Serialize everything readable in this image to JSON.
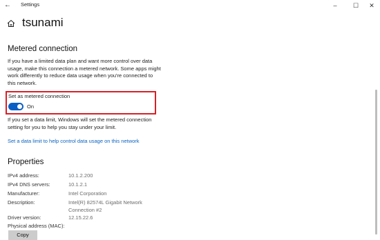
{
  "titlebar": {
    "back_glyph": "←",
    "title": "Settings",
    "minimize_glyph": "–",
    "maximize_glyph": "☐",
    "close_glyph": "✕"
  },
  "header": {
    "title": "tsunami",
    "icon": "home-icon"
  },
  "metered": {
    "heading": "Metered connection",
    "description_lines": [
      "If you have a limited data plan and want more control over data",
      "usage, make this connection a metered network. Some apps might",
      "work differently to reduce data usage when you're connected to",
      "this network."
    ],
    "toggle_label": "Set as metered connection",
    "toggle_state": "On",
    "toggle_on": true,
    "highlight_color": "#d81f26",
    "limit_lines": [
      "If you set a data limit, Windows will set the metered connection",
      "setting for you to help you stay under your limit."
    ],
    "link": "Set a data limit to help control data usage on this network"
  },
  "properties": {
    "heading": "Properties",
    "rows": [
      {
        "label": "IPv4 address:",
        "value": "10.1.2.200"
      },
      {
        "label": "IPv4 DNS servers:",
        "value": "10.1.2.1"
      },
      {
        "label": "Manufacturer:",
        "value": "Intel Corporation"
      },
      {
        "label": "Description:",
        "value": "Intel(R) 82574L Gigabit Network Connection #2"
      },
      {
        "label": "Driver version:",
        "value": "12.15.22.6"
      },
      {
        "label": "Physical address (MAC):",
        "value": ""
      }
    ],
    "copy_label": "Copy"
  },
  "colors": {
    "accent": "#0a5fc4",
    "link": "#0b63c1"
  }
}
